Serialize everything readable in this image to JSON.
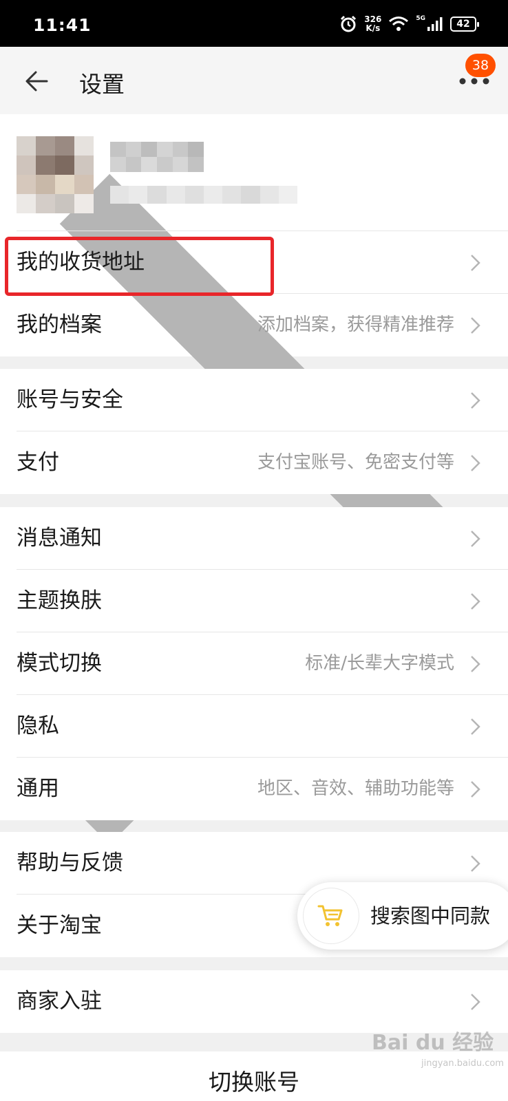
{
  "status_bar": {
    "time": "11:41",
    "net_speed_value": "326",
    "net_speed_unit": "K/s",
    "network": "5G",
    "battery": "42"
  },
  "nav": {
    "title": "设置",
    "badge_count": "38"
  },
  "menu": {
    "address": "我的收货地址",
    "profile_archive": "我的档案",
    "profile_archive_hint": "添加档案，获得精准推荐",
    "account_security": "账号与安全",
    "payment": "支付",
    "payment_hint": "支付宝账号、免密支付等",
    "notifications": "消息通知",
    "theme": "主题换肤",
    "mode_switch": "模式切换",
    "mode_switch_hint": "标准/长辈大字模式",
    "privacy": "隐私",
    "general": "通用",
    "general_hint": "地区、音效、辅助功能等",
    "help_feedback": "帮助与反馈",
    "about": "关于淘宝",
    "merchant": "商家入驻",
    "switch_account": "切换账号"
  },
  "floating_button": {
    "label": "搜索图中同款"
  },
  "watermark": {
    "text": "Bai du 经验",
    "sub": "jingyan.baidu.com"
  },
  "colors": {
    "accent": "#ff5000",
    "highlight": "#e8262a",
    "cart_icon": "#f2c230"
  }
}
